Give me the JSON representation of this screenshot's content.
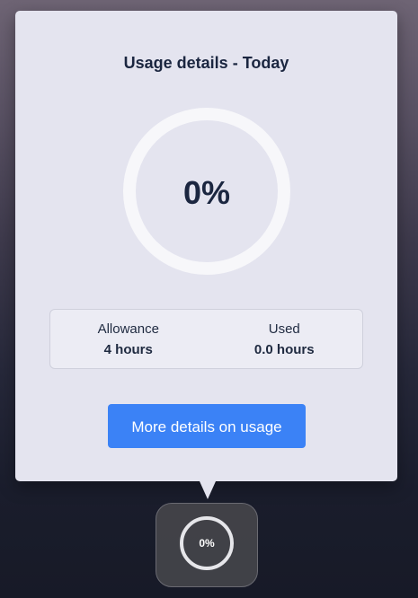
{
  "popup": {
    "title": "Usage details - Today",
    "progress_percent": 0,
    "progress_label": "0%",
    "stats": [
      {
        "label": "Allowance",
        "value": "4 hours"
      },
      {
        "label": "Used",
        "value": "0.0 hours"
      }
    ],
    "more_button": "More details on usage"
  },
  "tray": {
    "progress_label": "0%"
  },
  "colors": {
    "accent": "#3b82f6",
    "panel": "#e4e4ef",
    "text": "#1b2640"
  }
}
